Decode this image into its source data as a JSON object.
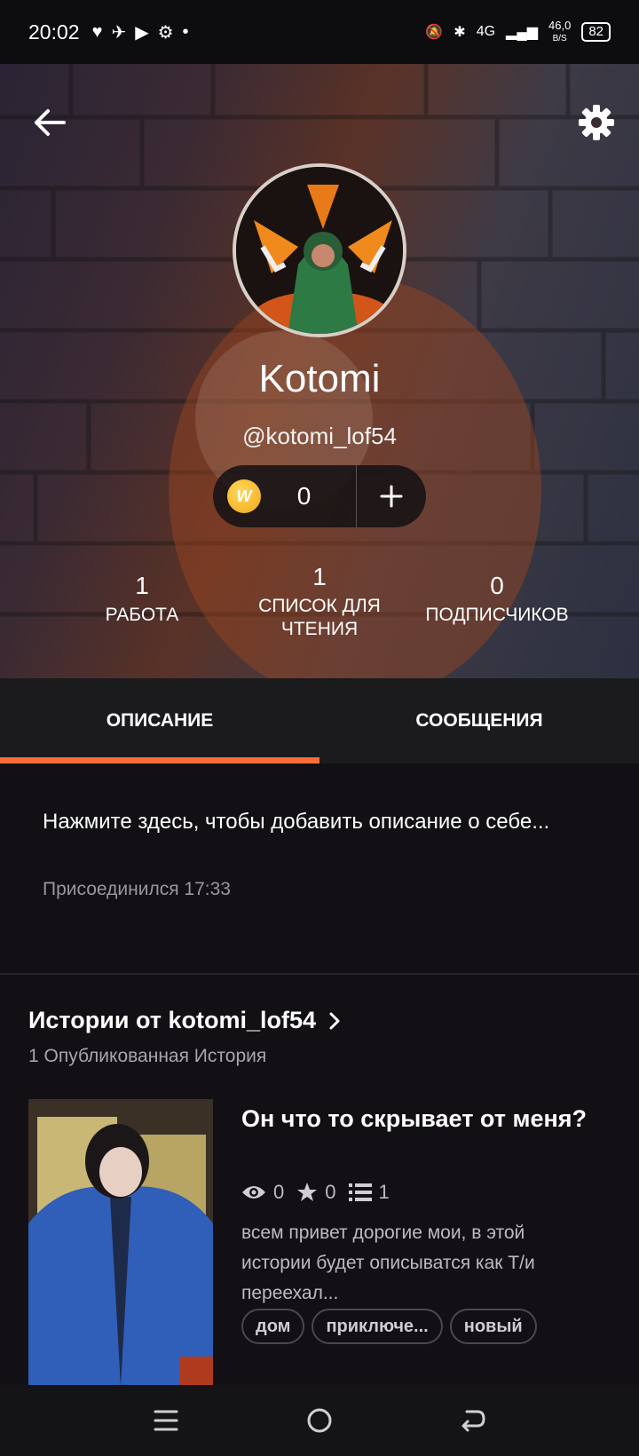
{
  "status_bar": {
    "time": "20:02",
    "network": "4G",
    "speed": "46,0",
    "speed_unit": "B/S",
    "battery": "82"
  },
  "profile": {
    "display_name": "Kotomi",
    "username": "@kotomi_lof54",
    "coins": "0",
    "coin_icon_letter": "W",
    "stats": [
      {
        "value": "1",
        "label": "РАБОТА"
      },
      {
        "value": "1",
        "label": "СПИСОК ДЛЯ ЧТЕНИЯ"
      },
      {
        "value": "0",
        "label": "ПОДПИСЧИКОВ"
      }
    ]
  },
  "tabs": [
    {
      "label": "ОПИСАНИЕ",
      "active": true
    },
    {
      "label": "СООБЩЕНИЯ",
      "active": false
    }
  ],
  "about": {
    "placeholder": "Нажмите здесь, чтобы добавить описание о себе...",
    "joined": "Присоединился 17:33"
  },
  "stories": {
    "title": "Истории от kotomi_lof54",
    "subtitle": "1 Опубликованная История",
    "items": [
      {
        "title": "Он что то скрывает от меня?",
        "views": "0",
        "votes": "0",
        "parts": "1",
        "description": "всем привет дорогие мои, в этой истории будет описыватся как Т/и переехал...",
        "tags": [
          "дом",
          "приключе...",
          "новый"
        ]
      }
    ]
  },
  "colors": {
    "accent": "#ff6c36",
    "background": "#121014",
    "tab_bar": "#1b1a1d",
    "coin": "#f0a81a"
  },
  "icons": [
    "back-arrow-icon",
    "gear-icon",
    "plus-icon",
    "eye-icon",
    "star-icon",
    "list-icon",
    "chevron-right-icon",
    "menu-icon",
    "home-circle-icon",
    "return-icon"
  ]
}
